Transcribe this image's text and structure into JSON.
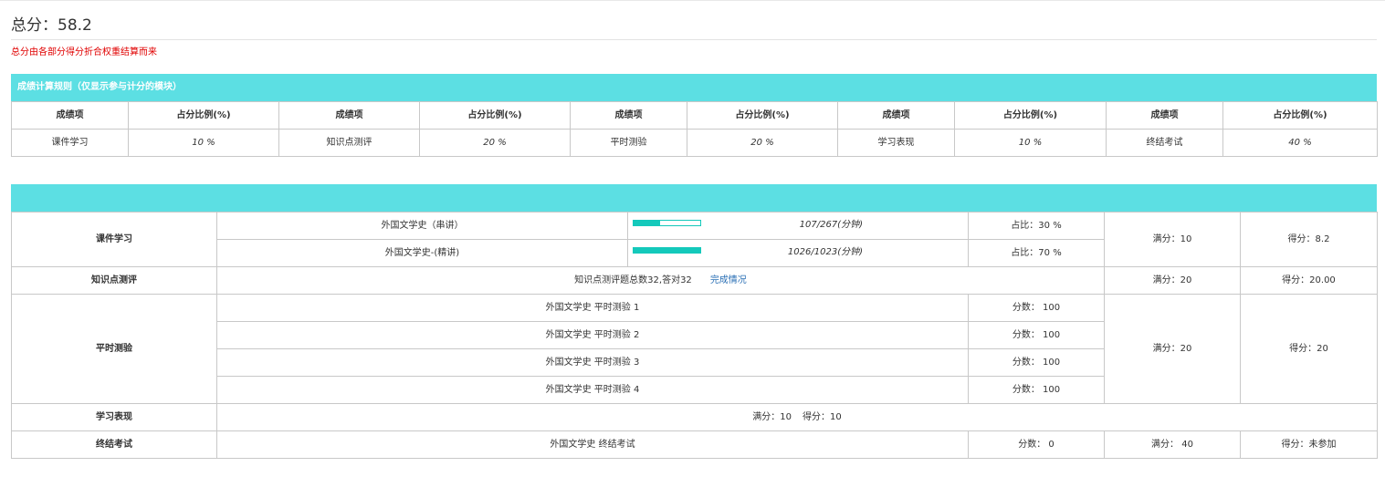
{
  "header": {
    "total_label": "总分：",
    "total_value": "58.2",
    "note": "总分由各部分得分折合权重结算而来"
  },
  "rules": {
    "title": "成绩计算规则（仅显示参与计分的模块）",
    "col_item": "成绩项",
    "col_ratio": "占分比例(%)",
    "items": [
      {
        "name": "课件学习",
        "ratio": "10 %"
      },
      {
        "name": "知识点测评",
        "ratio": "20 %"
      },
      {
        "name": "平时测验",
        "ratio": "20 %"
      },
      {
        "name": "学习表现",
        "ratio": "10 %"
      },
      {
        "name": "终结考试",
        "ratio": "40 %"
      }
    ]
  },
  "detail": {
    "courseware": {
      "label": "课件学习",
      "rows": [
        {
          "name": "外国文学史（串讲）",
          "progress": 0.4,
          "minutes": "107/267(分钟)",
          "share": "占比：30 %"
        },
        {
          "name": "外国文学史-(精讲)",
          "progress": 1.0,
          "minutes": "1026/1023(分钟)",
          "share": "占比：70 %"
        }
      ],
      "full": "满分：10",
      "score": "得分：8.2"
    },
    "knowledge": {
      "label": "知识点测评",
      "summary": "知识点测评题总数32,答对32",
      "link": "完成情况",
      "full": "满分：20",
      "score": "得分：20.00"
    },
    "quiz": {
      "label": "平时测验",
      "rows": [
        {
          "name": "外国文学史 平时测验 1",
          "score": "分数： 100"
        },
        {
          "name": "外国文学史 平时测验 2",
          "score": "分数： 100"
        },
        {
          "name": "外国文学史 平时测验 3",
          "score": "分数： 100"
        },
        {
          "name": "外国文学史 平时测验 4",
          "score": "分数： 100"
        }
      ],
      "full": "满分：20",
      "score": "得分：20"
    },
    "performance": {
      "label": "学习表现",
      "full": "满分：10",
      "score": "得分：10"
    },
    "final": {
      "label": "终结考试",
      "name": "外国文学史 终结考试",
      "exam_score": "分数： 0",
      "full": "满分： 40",
      "score": "得分：未参加"
    }
  },
  "colors": {
    "header_bar": "#5cdfe3",
    "progress": "#14c9bb",
    "note": "#e00000",
    "link": "#2a6fb5"
  }
}
